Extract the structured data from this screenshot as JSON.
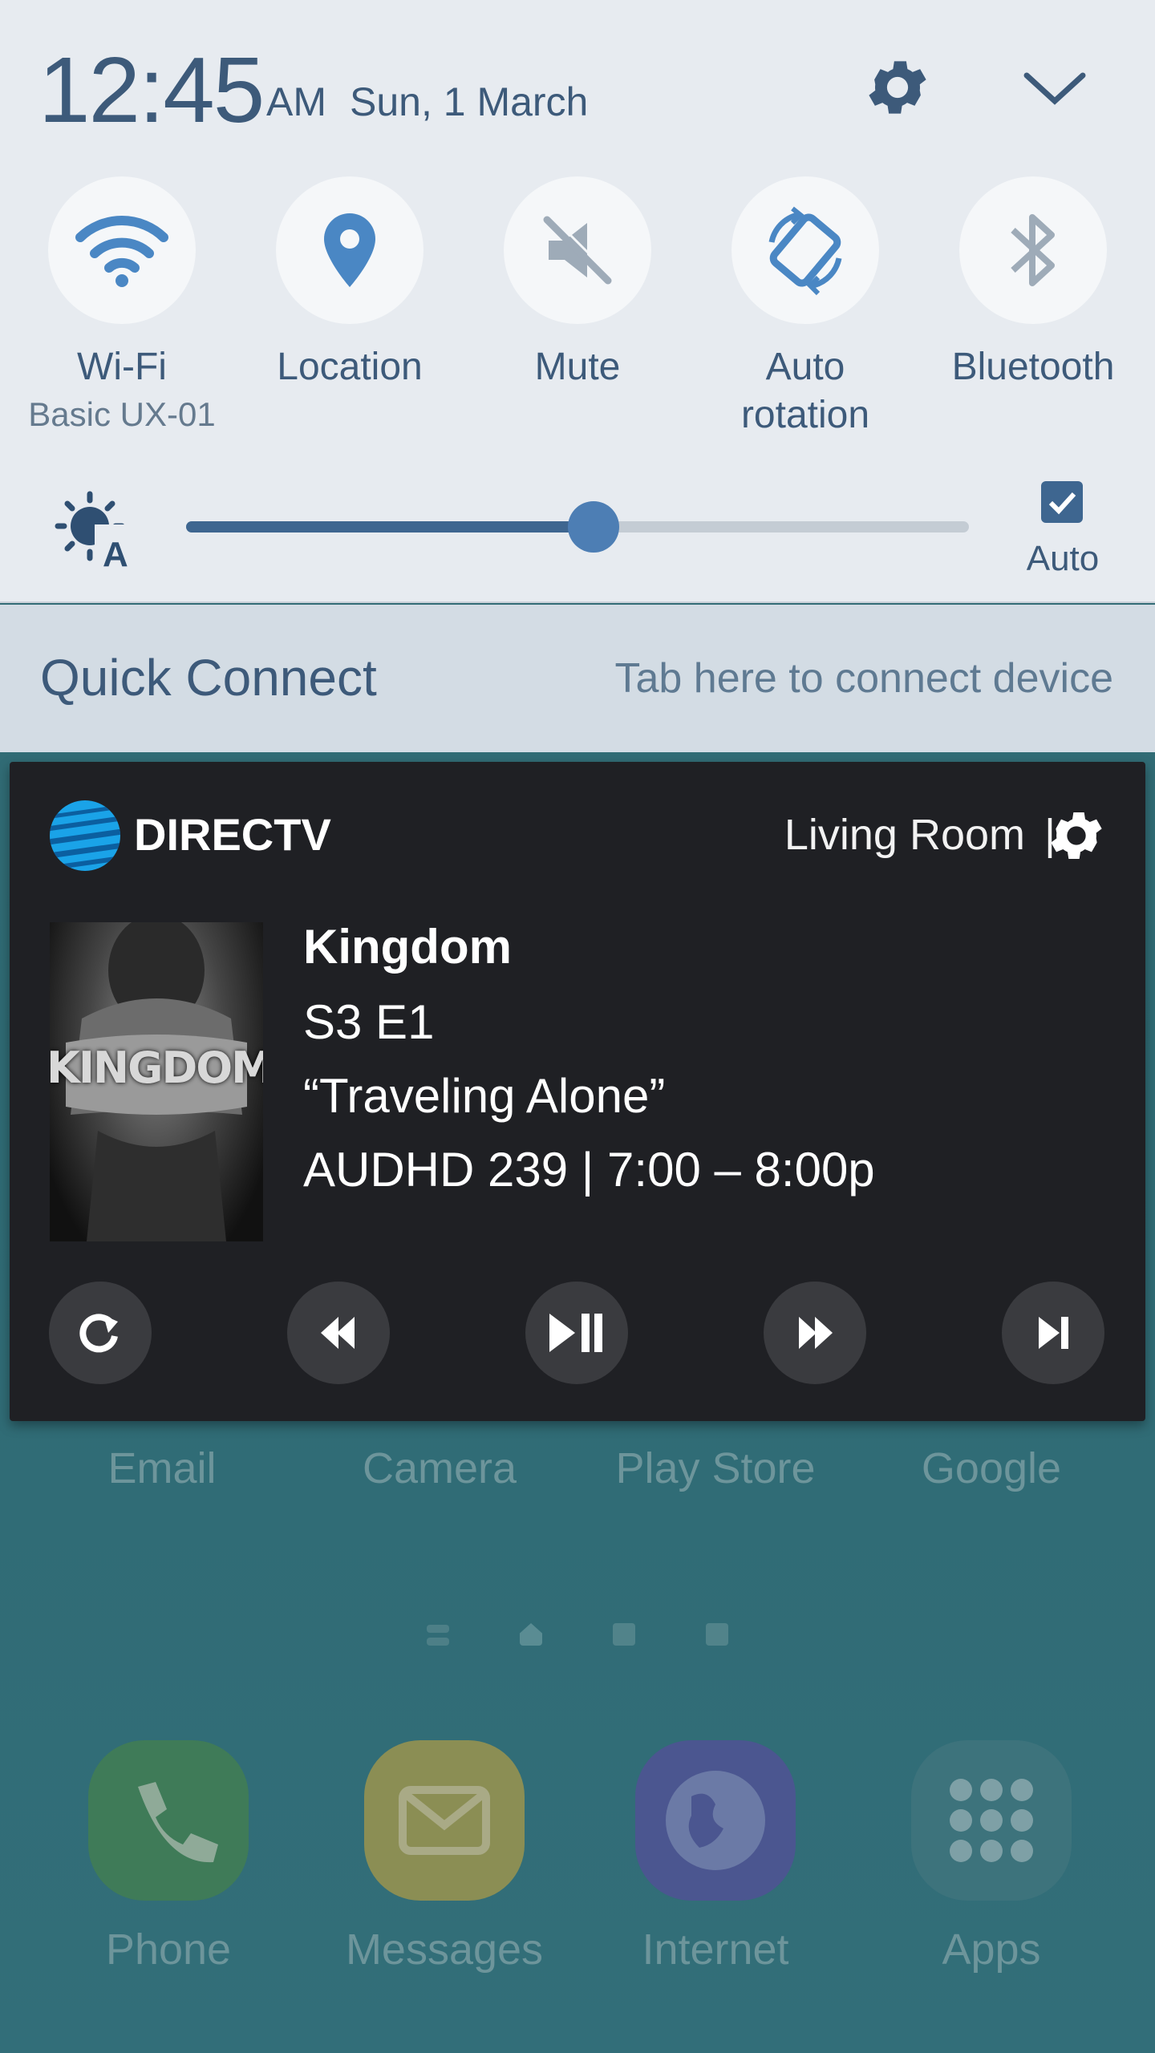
{
  "status": {
    "time": "12:45",
    "ampm": "AM",
    "date": "Sun, 1 March"
  },
  "quick_tiles": [
    {
      "label": "Wi-Fi",
      "sublabel": "Basic UX-01",
      "icon": "wifi-icon",
      "active": true
    },
    {
      "label": "Location",
      "icon": "location-pin-icon",
      "active": true
    },
    {
      "label": "Mute",
      "icon": "mute-icon",
      "active": false
    },
    {
      "label": "Auto rotation",
      "icon": "auto-rotate-icon",
      "active": true
    },
    {
      "label": "Bluetooth",
      "icon": "bluetooth-icon",
      "active": false
    }
  ],
  "brightness": {
    "level": 0.52,
    "auto_label": "Auto",
    "auto_checked": true
  },
  "quick_connect": {
    "title": "Quick Connect",
    "hint": "Tab here to connect device"
  },
  "directv": {
    "brand": "DIRECTV",
    "room": "Living Room",
    "separator": "|",
    "poster_text": "KINGDOM",
    "show": {
      "title": "Kingdom",
      "episode": "S3 E1",
      "episode_title": "“Traveling Alone”",
      "channel_time": "AUDHD 239 | 7:00 – 8:00p"
    },
    "controls": [
      "replay-icon",
      "rewind-icon",
      "play-pause-icon",
      "fast-forward-icon",
      "skip-next-icon"
    ]
  },
  "home": {
    "apps_row": [
      "Email",
      "Camera",
      "Play Store",
      "Google"
    ],
    "dock": [
      "Phone",
      "Messages",
      "Internet",
      "Apps"
    ]
  },
  "colors": {
    "accent": "#4d7eb4",
    "shade_bg": "#e7ebf0",
    "card_bg": "#1f2024",
    "att_blue": "#1aa3e8"
  }
}
